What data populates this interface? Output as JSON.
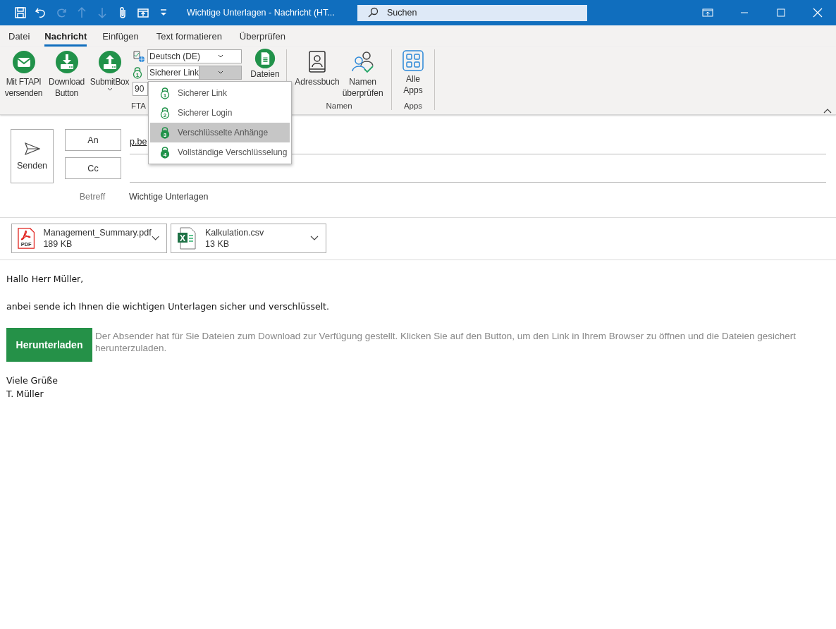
{
  "window": {
    "title": "Wichtige Unterlagen  -  Nachricht (HT...",
    "search_placeholder": "Suchen"
  },
  "quick_access": [
    {
      "kind": "save",
      "disabled": false
    },
    {
      "kind": "undo",
      "disabled": false
    },
    {
      "kind": "redo",
      "disabled": true
    },
    {
      "kind": "up",
      "disabled": true
    },
    {
      "kind": "down",
      "disabled": true
    },
    {
      "kind": "attach",
      "disabled": false
    },
    {
      "kind": "window",
      "disabled": false
    },
    {
      "kind": "more",
      "disabled": false
    }
  ],
  "ribbon_tabs": [
    {
      "label": "Datei",
      "selected": false
    },
    {
      "label": "Nachricht",
      "selected": true
    },
    {
      "label": "Einfügen",
      "selected": false
    },
    {
      "label": "Text formatieren",
      "selected": false
    },
    {
      "label": "Überprüfen",
      "selected": false
    }
  ],
  "ftapi_group": {
    "buttons": [
      {
        "kind": "mail",
        "lines": [
          "Mit FTAPI",
          "versenden"
        ]
      },
      {
        "kind": "download",
        "lines": [
          "Download",
          "Button"
        ]
      },
      {
        "kind": "upload",
        "lines": [
          "SubmitBox"
        ],
        "has_menu": true
      }
    ],
    "language": "Deutsch (DE)",
    "security_icon_number": "1",
    "security": "Sicherer Link",
    "expiry_days": "90",
    "files_button": "Dateien",
    "label": "FTA"
  },
  "security_menu": [
    {
      "label": "Sicherer Link",
      "number": "1",
      "filled": false,
      "selected": false
    },
    {
      "label": "Sicherer Login",
      "number": "2",
      "filled": false,
      "selected": false
    },
    {
      "label": "Verschlüsselte Anhänge",
      "number": "3",
      "filled": true,
      "selected": true
    },
    {
      "label": "Vollständige Verschlüsselung",
      "number": "4",
      "filled": true,
      "selected": false
    }
  ],
  "names_group": {
    "buttons": [
      {
        "kind": "addressbook",
        "lines": [
          "Adressbuch"
        ]
      },
      {
        "kind": "checknames",
        "lines": [
          "Namen",
          "überprüfen"
        ]
      }
    ],
    "label": "Namen"
  },
  "apps_group": {
    "buttons": [
      {
        "kind": "apps",
        "lines": [
          "Alle",
          "Apps"
        ]
      }
    ],
    "label": "Apps"
  },
  "compose": {
    "send": "Senden",
    "to_label": "An",
    "to_value": "p.be",
    "cc_label": "Cc",
    "subject_label": "Betreff",
    "subject": "Wichtige Unterlagen"
  },
  "attachments": [
    {
      "kind": "pdf",
      "icon_text": "PDF",
      "name": "Management_Summary.pdf",
      "size": "189 KB"
    },
    {
      "kind": "excel",
      "icon_text": "X",
      "name": "Kalkulation.csv",
      "size": "13 KB"
    }
  ],
  "body": {
    "greeting": "Hallo Herr Müller,",
    "paragraph": "anbei sende ich Ihnen die wichtigen Unterlagen sicher und verschlüsselt.",
    "download_button": "Herunterladen",
    "note": "Der Absender hat für Sie Dateien zum Download zur Verfügung gestellt. Klicken Sie auf den Button, um den Link in Ihrem Browser zu öffnen und die Dateien gesichert herunterzuladen.",
    "closing": [
      "Viele Grüße",
      "T. Müller"
    ]
  }
}
